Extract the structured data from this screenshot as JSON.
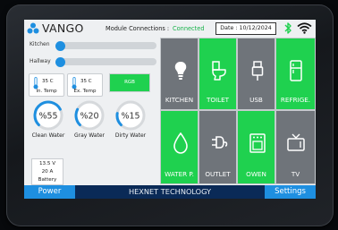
{
  "header": {
    "brand": "VANGO",
    "connections_label": "Module Connections :",
    "connections_status": "Connected",
    "date": "Date : 10/12/2024"
  },
  "sliders": [
    {
      "label": "Kitchen",
      "level": 0.0
    },
    {
      "label": "Hallway",
      "level": 0.0
    }
  ],
  "temps": [
    {
      "value": "35 C",
      "label": "In. Temp"
    },
    {
      "value": "35 C",
      "label": "Ex. Temp"
    }
  ],
  "rgb_label": "RGB",
  "tanks": [
    {
      "value": "%55",
      "label": "Clean Water",
      "percent": 55
    },
    {
      "value": "%20",
      "label": "Gray Water",
      "percent": 20
    },
    {
      "value": "%15",
      "label": "Dirty Water",
      "percent": 15
    }
  ],
  "battery": {
    "voltage": "13.5 V",
    "current": "20 A",
    "label": "Battery"
  },
  "tiles": [
    {
      "label": "KITCHEN",
      "icon": "bulb-icon",
      "on": false
    },
    {
      "label": "TOILET",
      "icon": "toilet-icon",
      "on": true
    },
    {
      "label": "USB",
      "icon": "usb-icon",
      "on": false
    },
    {
      "label": "REFRIGE.",
      "icon": "fridge-icon",
      "on": true
    },
    {
      "label": "WATER P.",
      "icon": "water-drop-icon",
      "on": true
    },
    {
      "label": "OUTLET",
      "icon": "outlet-icon",
      "on": false
    },
    {
      "label": "OWEN",
      "icon": "oven-icon",
      "on": true
    },
    {
      "label": "TV",
      "icon": "tv-icon",
      "on": false
    }
  ],
  "footer": {
    "power_label": "Power",
    "title": "HEXNET TECHNOLOGY",
    "settings_label": "Settings"
  },
  "colors": {
    "accent": "#1e8fe0",
    "on": "#1fd14f",
    "off": "#6f747a",
    "footer": "#0a2a57"
  }
}
